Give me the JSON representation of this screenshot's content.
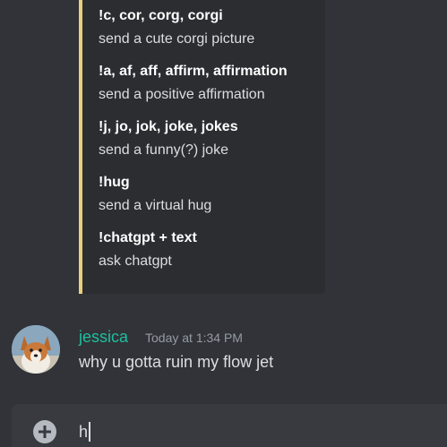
{
  "embed": {
    "accent_color": "#e8d07a",
    "fields": [
      {
        "name": "!c, cor, corg, corgi",
        "value": "send a cute corgi picture"
      },
      {
        "name": "!a, af, aff, affirm, affirmation",
        "value": "send a positive affirmation"
      },
      {
        "name": "!j, jo, jok, joke, jokes",
        "value": "send a funny(?) joke"
      },
      {
        "name": "!hug",
        "value": "send a virtual hug"
      },
      {
        "name": "!chatgpt + text",
        "value": "ask chatgpt"
      }
    ]
  },
  "message": {
    "username": "jessica",
    "username_color": "#1fbf9e",
    "timestamp": "Today at 1:34 PM",
    "text": "why u gotta ruin my flow jet",
    "avatar_icon": "corgi-avatar"
  },
  "composer": {
    "value": "h",
    "add_icon": "plus-circle-icon"
  }
}
